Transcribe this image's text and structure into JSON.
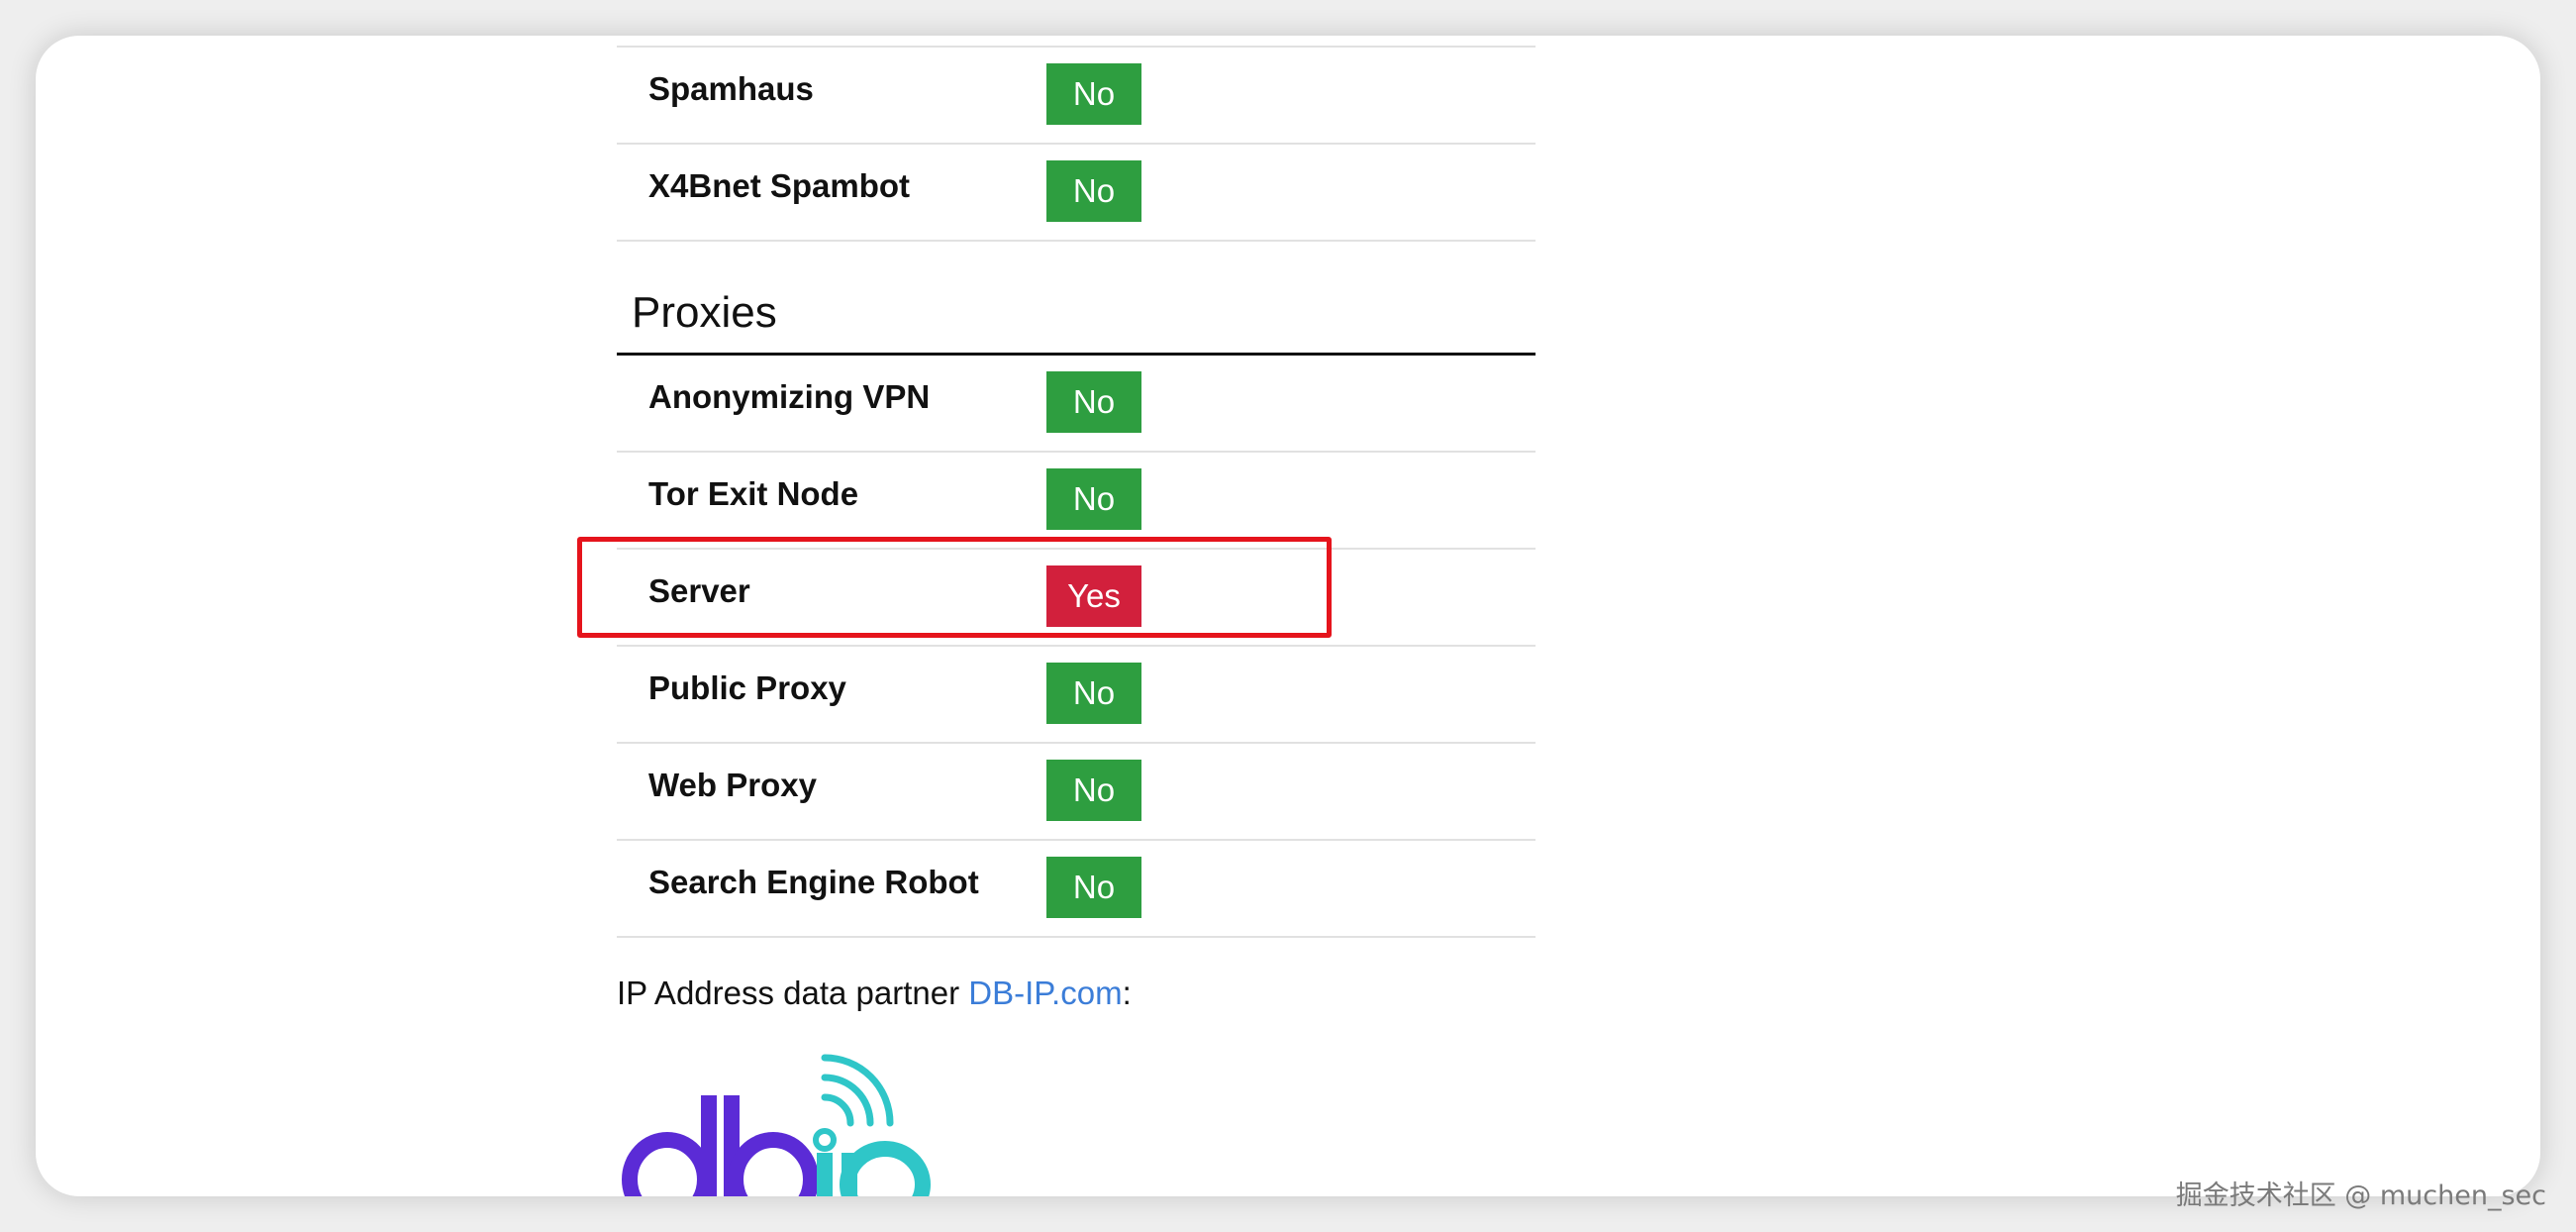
{
  "rows_top": [
    {
      "label": "Spamhaus",
      "status": "No"
    },
    {
      "label": "X4Bnet Spambot",
      "status": "No"
    }
  ],
  "section": {
    "title": "Proxies"
  },
  "rows_proxies": [
    {
      "label": "Anonymizing VPN",
      "status": "No"
    },
    {
      "label": "Tor Exit Node",
      "status": "No"
    },
    {
      "label": "Server",
      "status": "Yes"
    },
    {
      "label": "Public Proxy",
      "status": "No"
    },
    {
      "label": "Web Proxy",
      "status": "No"
    },
    {
      "label": "Search Engine Robot",
      "status": "No"
    }
  ],
  "partner": {
    "prefix": "IP Address data partner ",
    "link": "DB-IP.com",
    "suffix": ":"
  },
  "logo": {
    "text": "dbip"
  },
  "watermark": "掘金技术社区 @ muchen_sec",
  "colors": {
    "no": "#2e9e40",
    "yes": "#d2203c",
    "highlight": "#e5141c",
    "link": "#3b7dd8",
    "logo_d": "#5b2bd6",
    "logo_ip": "#2fc6c8"
  }
}
